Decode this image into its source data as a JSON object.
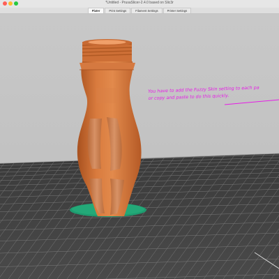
{
  "window": {
    "title": "*Untitled - PrusaSlicer-2.4.0 based on Slic3r"
  },
  "tabs": [
    {
      "label": "Plater",
      "active": true
    },
    {
      "label": "Print Settings",
      "active": false
    },
    {
      "label": "Filament Settings",
      "active": false
    },
    {
      "label": "Printer Settings",
      "active": false
    }
  ],
  "viewport": {
    "annotation": "You have to add the Fuzzy Skin setting to each pa\nor copy and paste to do this quickly.",
    "colors": {
      "background": "#c4c4c4",
      "bed": "#3f3f3f",
      "bed_grid": "#9a9a9a",
      "model": "#d3733b",
      "brim": "#1e9b6f",
      "annotation": "#e61ce6"
    }
  }
}
